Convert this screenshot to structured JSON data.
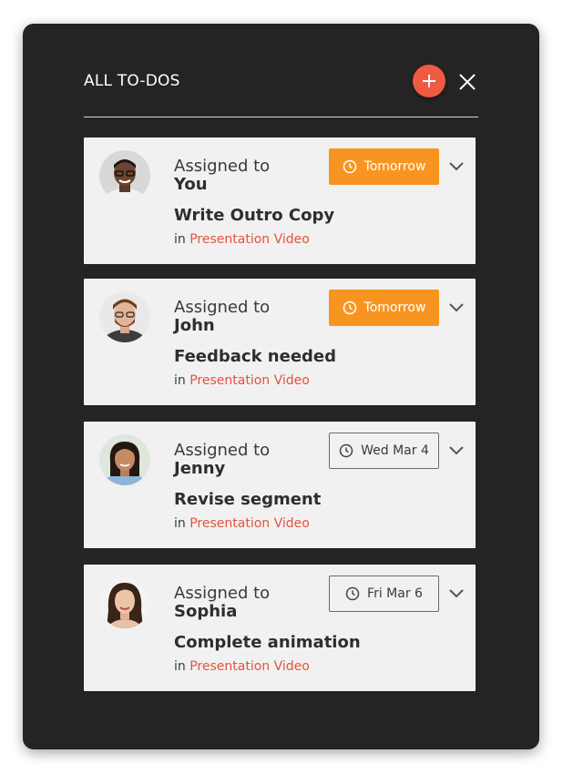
{
  "header": {
    "title": "ALL TO-DOS"
  },
  "colors": {
    "accent": "#f05a42",
    "urgent_badge": "#f89521",
    "link": "#e5523b",
    "panel_bg": "#242424",
    "card_bg": "#f1f1f1"
  },
  "todos": [
    {
      "assigned_label": "Assigned to",
      "assignee": "You",
      "task": "Write Outro Copy",
      "in_label": "in",
      "project": "Presentation Video",
      "due": "Tomorrow",
      "due_style": "urgent",
      "avatar": "man-glasses-avatar"
    },
    {
      "assigned_label": "Assigned to",
      "assignee": "John",
      "task": "Feedback needed",
      "in_label": "in",
      "project": "Presentation Video",
      "due": "Tomorrow",
      "due_style": "urgent",
      "avatar": "man-beard-avatar"
    },
    {
      "assigned_label": "Assigned to",
      "assignee": "Jenny",
      "task": "Revise segment",
      "in_label": "in",
      "project": "Presentation Video",
      "due": "Wed Mar 4",
      "due_style": "normal",
      "avatar": "woman-dark-hair-avatar"
    },
    {
      "assigned_label": "Assigned to",
      "assignee": "Sophia",
      "task": "Complete animation",
      "in_label": "in",
      "project": "Presentation Video",
      "due": "Fri Mar 6",
      "due_style": "normal",
      "avatar": "woman-long-hair-avatar"
    }
  ]
}
